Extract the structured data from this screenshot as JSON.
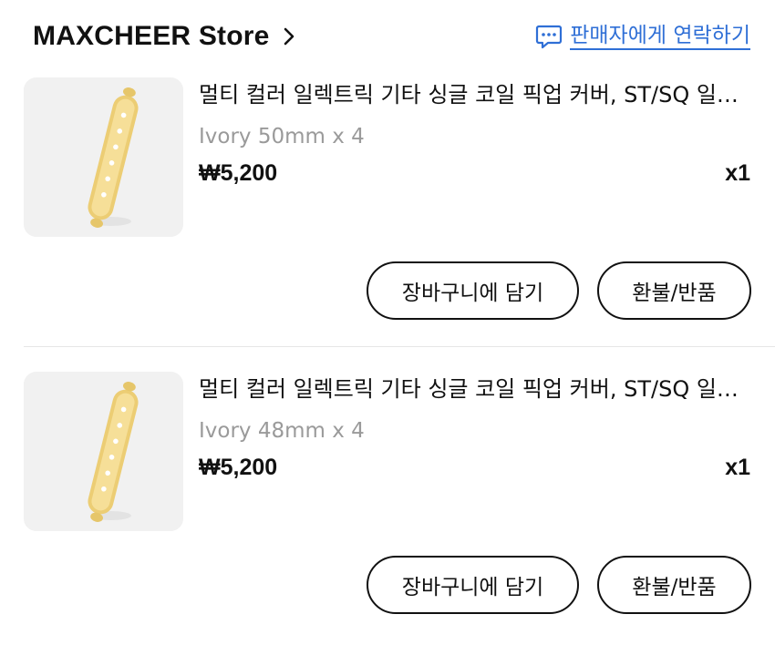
{
  "header": {
    "store_name": "MAXCHEER Store",
    "contact_label": "판매자에게 연락하기",
    "accent_color": "#2f6fd6"
  },
  "items": [
    {
      "title": "멀티 컬러 일렉트릭 기타 싱글 코일 픽업 커버, ST/SQ 일렉트릭 기타",
      "option": "Ivory 50mm x 4",
      "price": "₩5,200",
      "quantity": "x1",
      "add_to_cart_label": "장바구니에 담기",
      "refund_label": "환불/반품"
    },
    {
      "title": "멀티 컬러 일렉트릭 기타 싱글 코일 픽업 커버, ST/SQ 일렉트릭 기타",
      "option": "Ivory 48mm x 4",
      "price": "₩5,200",
      "quantity": "x1",
      "add_to_cart_label": "장바구니에 담기",
      "refund_label": "환불/반품"
    }
  ],
  "icons": {
    "store_chevron": "chevron-right-icon",
    "contact": "chat-bubble-icon",
    "product": "pickup-cover-image"
  }
}
